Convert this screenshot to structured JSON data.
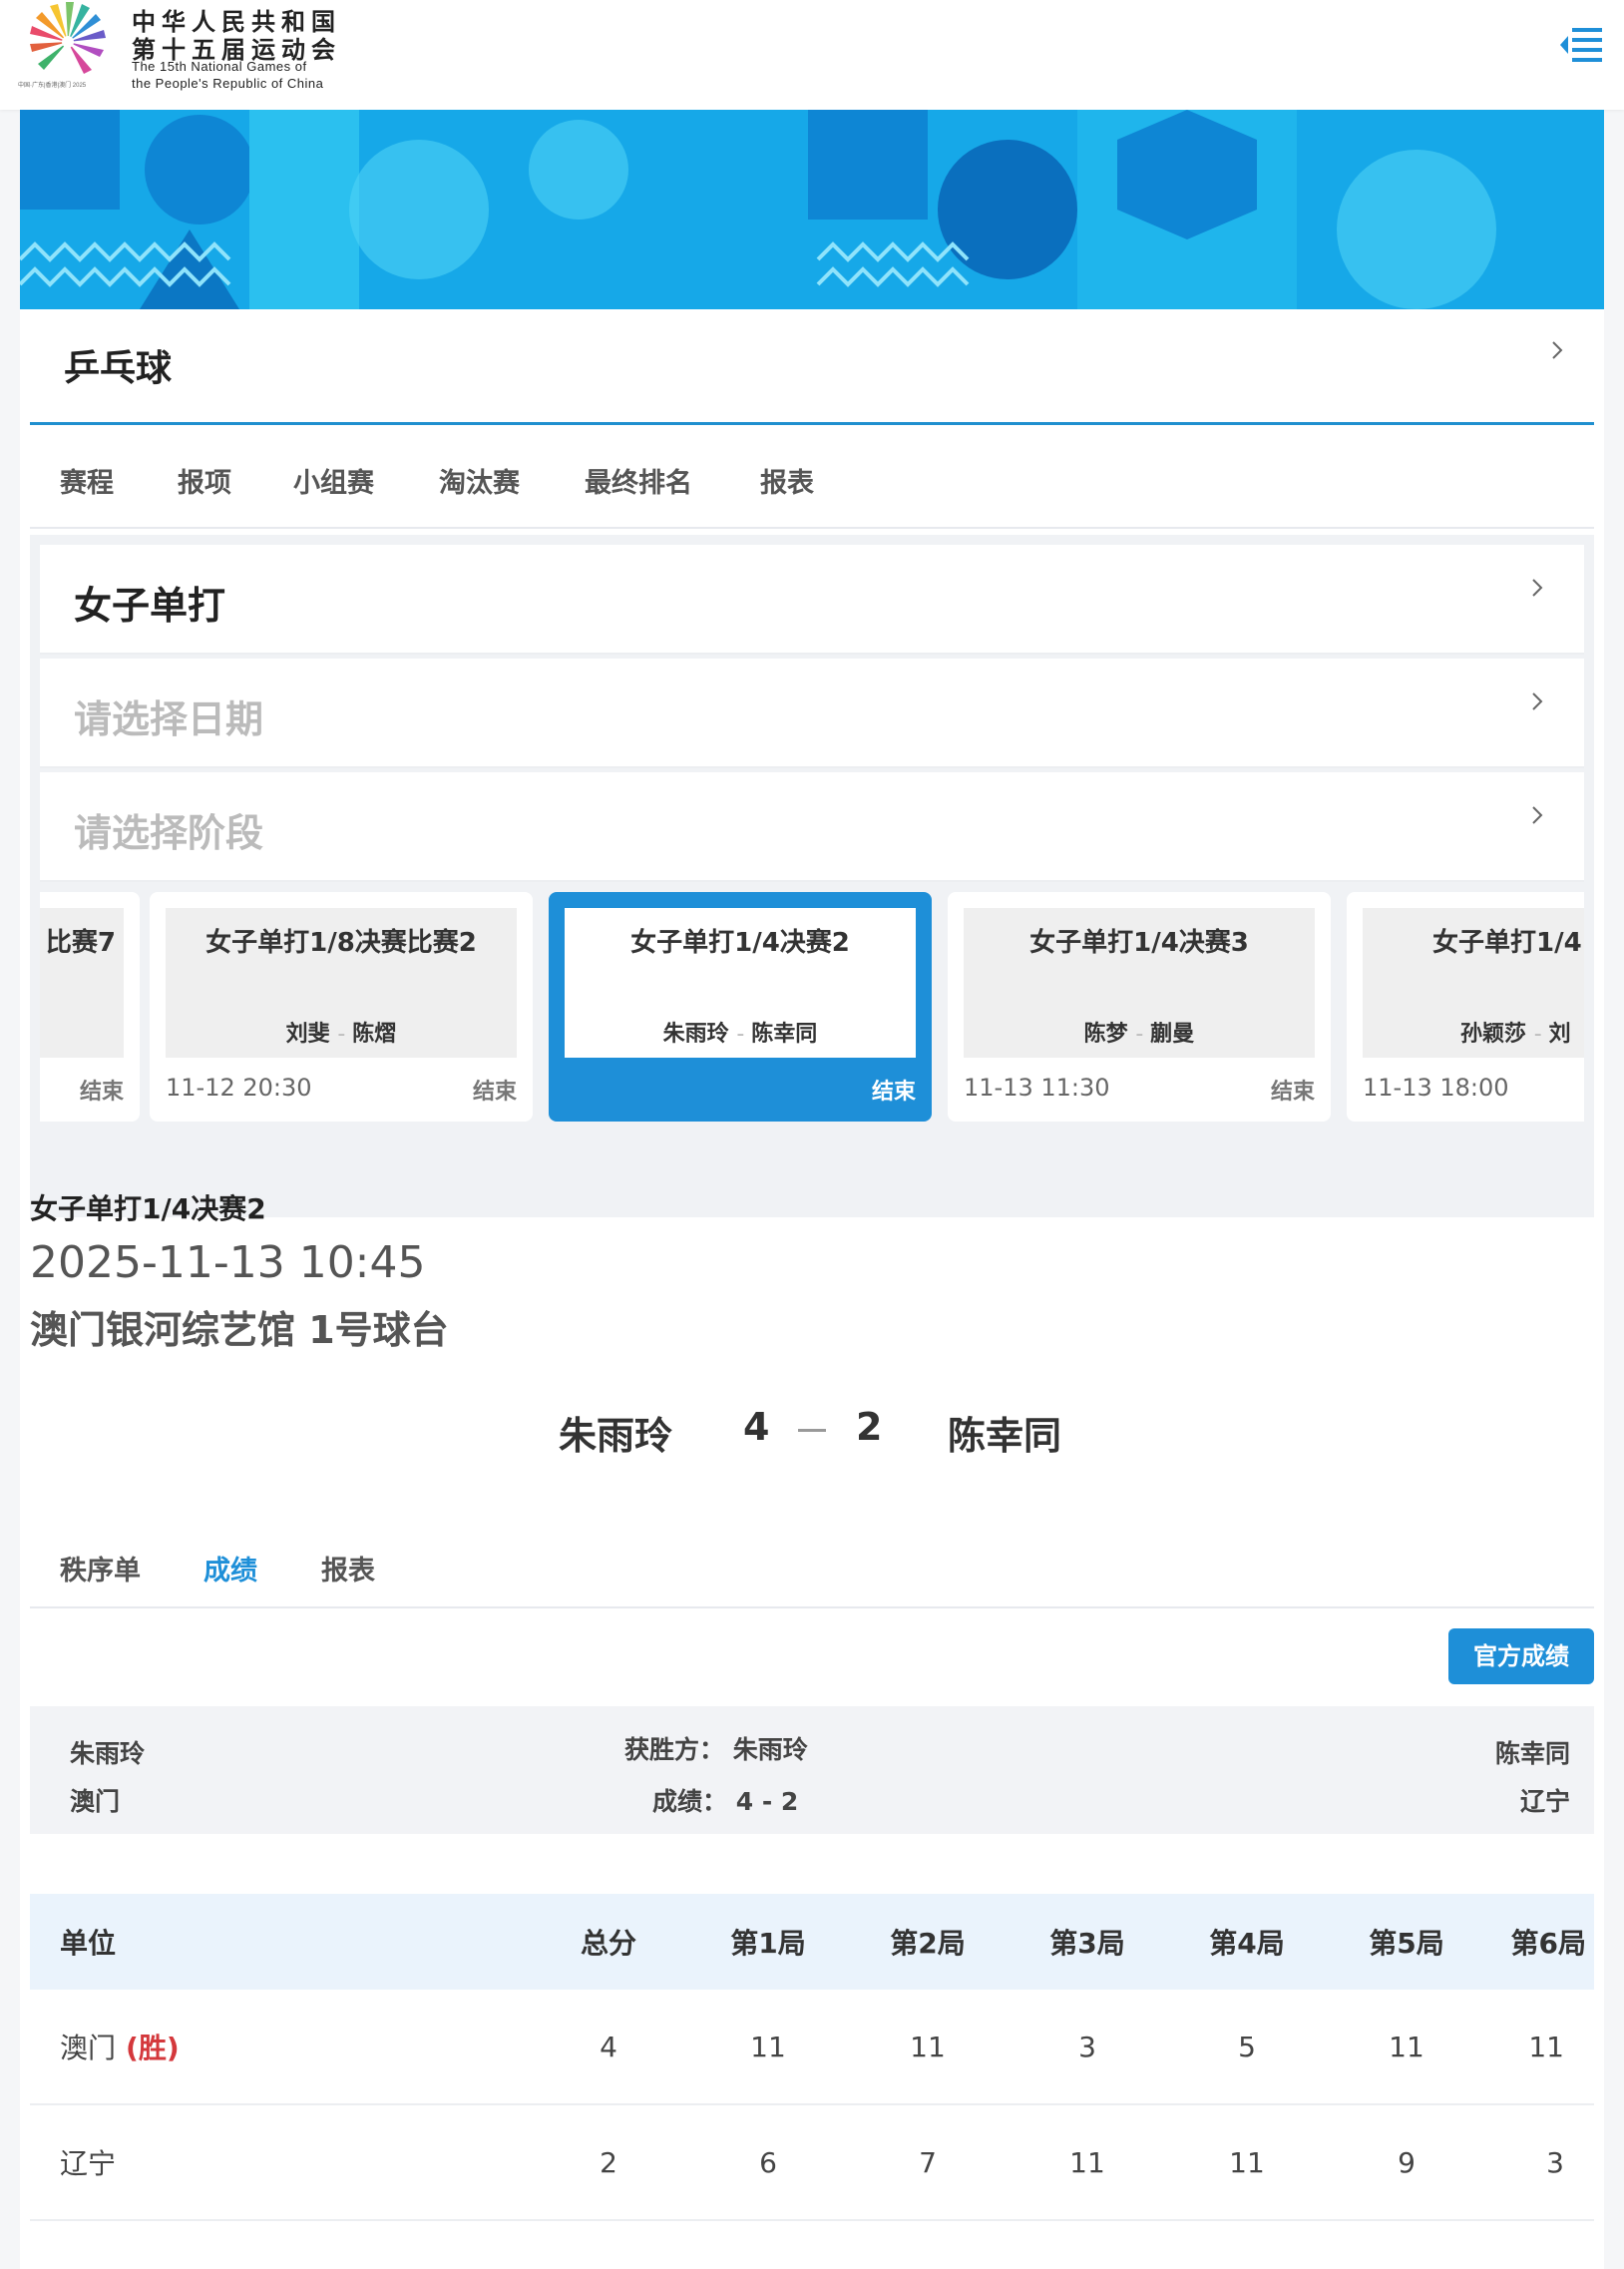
{
  "header": {
    "title_cn_line1": "中华人民共和国",
    "title_cn_line2": "第十五届运动会",
    "title_en_line1": "The 15th National Games of",
    "title_en_line2": "the People's Republic of China",
    "logo_subtext": "中国·广东|香港|澳门 2025",
    "menu_icon": "menu-list-icon"
  },
  "sport": {
    "title": "乒乓球"
  },
  "tabs": [
    "赛程",
    "报项",
    "小组赛",
    "淘汰赛",
    "最终排名",
    "报表"
  ],
  "selectors": {
    "event": "女子单打",
    "date_placeholder": "请选择日期",
    "stage_placeholder": "请选择阶段"
  },
  "match_cards": [
    {
      "title": "比赛7",
      "players_a": "",
      "players_b": "",
      "time": "",
      "status": "结束"
    },
    {
      "title": "女子单打1/8决赛比赛2",
      "players_a": "刘斐",
      "players_b": "陈熠",
      "time": "11-12 20:30",
      "status": "结束"
    },
    {
      "title": "女子单打1/4决赛2",
      "players_a": "朱雨玲",
      "players_b": "陈幸同",
      "time": "",
      "status": "结束"
    },
    {
      "title": "女子单打1/4决赛3",
      "players_a": "陈梦",
      "players_b": "蒯曼",
      "time": "11-13 11:30",
      "status": "结束"
    },
    {
      "title": "女子单打1/4",
      "players_a": "孙颖莎",
      "players_b": "刘",
      "time": "11-13 18:00",
      "status": ""
    }
  ],
  "match_detail": {
    "title": "女子单打1/4决赛2",
    "datetime": "2025-11-13 10:45",
    "venue": "澳门银河综艺馆 1号球台",
    "player1": "朱雨玲",
    "score1": "4",
    "score2": "2",
    "player2": "陈幸同"
  },
  "sub_tabs": [
    "秩序单",
    "成绩",
    "报表"
  ],
  "official_button": "官方成绩",
  "summary": {
    "left_name": "朱雨玲",
    "left_team": "澳门",
    "winner_label": "获胜方：",
    "winner_value": "朱雨玲",
    "score_label": "成绩：",
    "score_value": "4 - 2",
    "right_name": "陈幸同",
    "right_team": "辽宁"
  },
  "results": {
    "headers": [
      "单位",
      "总分",
      "第1局",
      "第2局",
      "第3局",
      "第4局",
      "第5局",
      "第6局"
    ],
    "rows": [
      {
        "unit": "澳门",
        "tag": "(胜)",
        "total": "4",
        "games": [
          "11",
          "11",
          "3",
          "5",
          "11",
          "11"
        ]
      },
      {
        "unit": "辽宁",
        "tag": "",
        "total": "2",
        "games": [
          "6",
          "7",
          "11",
          "11",
          "9",
          "3"
        ]
      }
    ]
  },
  "colors": {
    "accent": "#1e8fd8",
    "win": "#d4383c",
    "banner": "#13a3e6"
  }
}
